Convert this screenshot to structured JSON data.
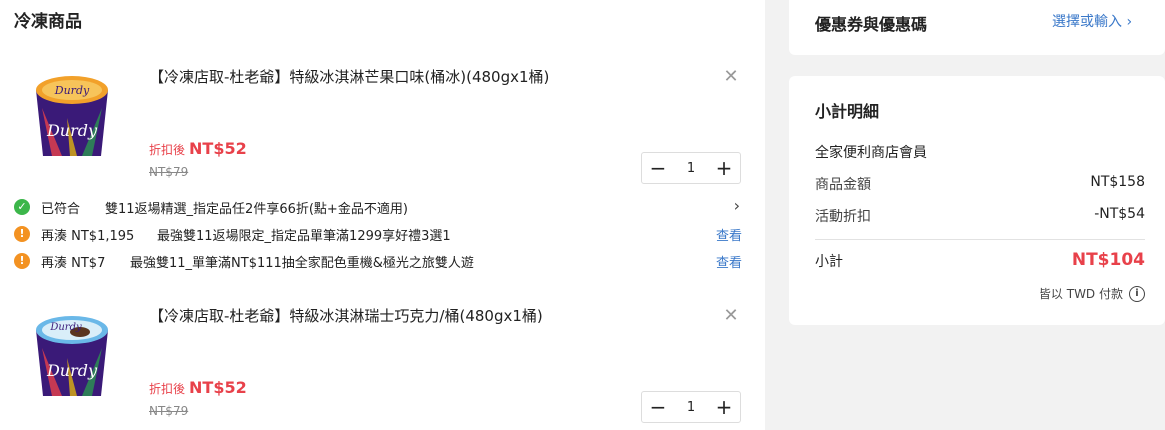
{
  "section": {
    "title": "冷凍商品"
  },
  "products": [
    {
      "name": "【冷凍店取-杜老爺】特級冰淇淋芒果口味(桶冰)(480gx1桶)",
      "discount_label": "折扣後",
      "discount_price": "NT$52",
      "original_price": "NT$79",
      "quantity": "1",
      "remove_icon": "✕",
      "minus": "−",
      "plus": "+"
    },
    {
      "name": "【冷凍店取-杜老爺】特級冰淇淋瑞士巧克力/桶(480gx1桶)",
      "discount_label": "折扣後",
      "discount_price": "NT$52",
      "original_price": "NT$79",
      "quantity": "1",
      "remove_icon": "✕",
      "minus": "−",
      "plus": "+"
    }
  ],
  "promotions": [
    {
      "status": "已符合",
      "text": "雙11返場精選_指定品任2件享66折(點+金品不適用)",
      "icon": "check-icon",
      "color": "#3cb64a",
      "chevron": "›"
    },
    {
      "status": "再湊 NT$1,195",
      "text": "最強雙11返場限定_指定品單筆滿1299享好禮3選1",
      "icon": "alert-icon",
      "color": "#f39222",
      "link": "查看"
    },
    {
      "status": "再湊 NT$7",
      "text": "最強雙11_單筆滿NT$111抽全家配色重機&極光之旅雙人遊",
      "icon": "alert-icon",
      "color": "#f39222",
      "link": "查看"
    }
  ],
  "coupon": {
    "title": "優惠券與優惠碼",
    "link": "選擇或輸入"
  },
  "summary": {
    "title": "小計明細",
    "member": "全家便利商店會員",
    "rows": [
      {
        "label": "商品金額",
        "value": "NT$158"
      },
      {
        "label": "活動折扣",
        "value": "-NT$54"
      }
    ],
    "subtotal_label": "小計",
    "subtotal_value": "NT$104",
    "currency_note": "皆以 TWD 付款"
  },
  "colors": {
    "accent_red": "#e8414a",
    "link_blue": "#3a78c9",
    "check_green": "#3cb64a",
    "alert_orange": "#f39222"
  }
}
